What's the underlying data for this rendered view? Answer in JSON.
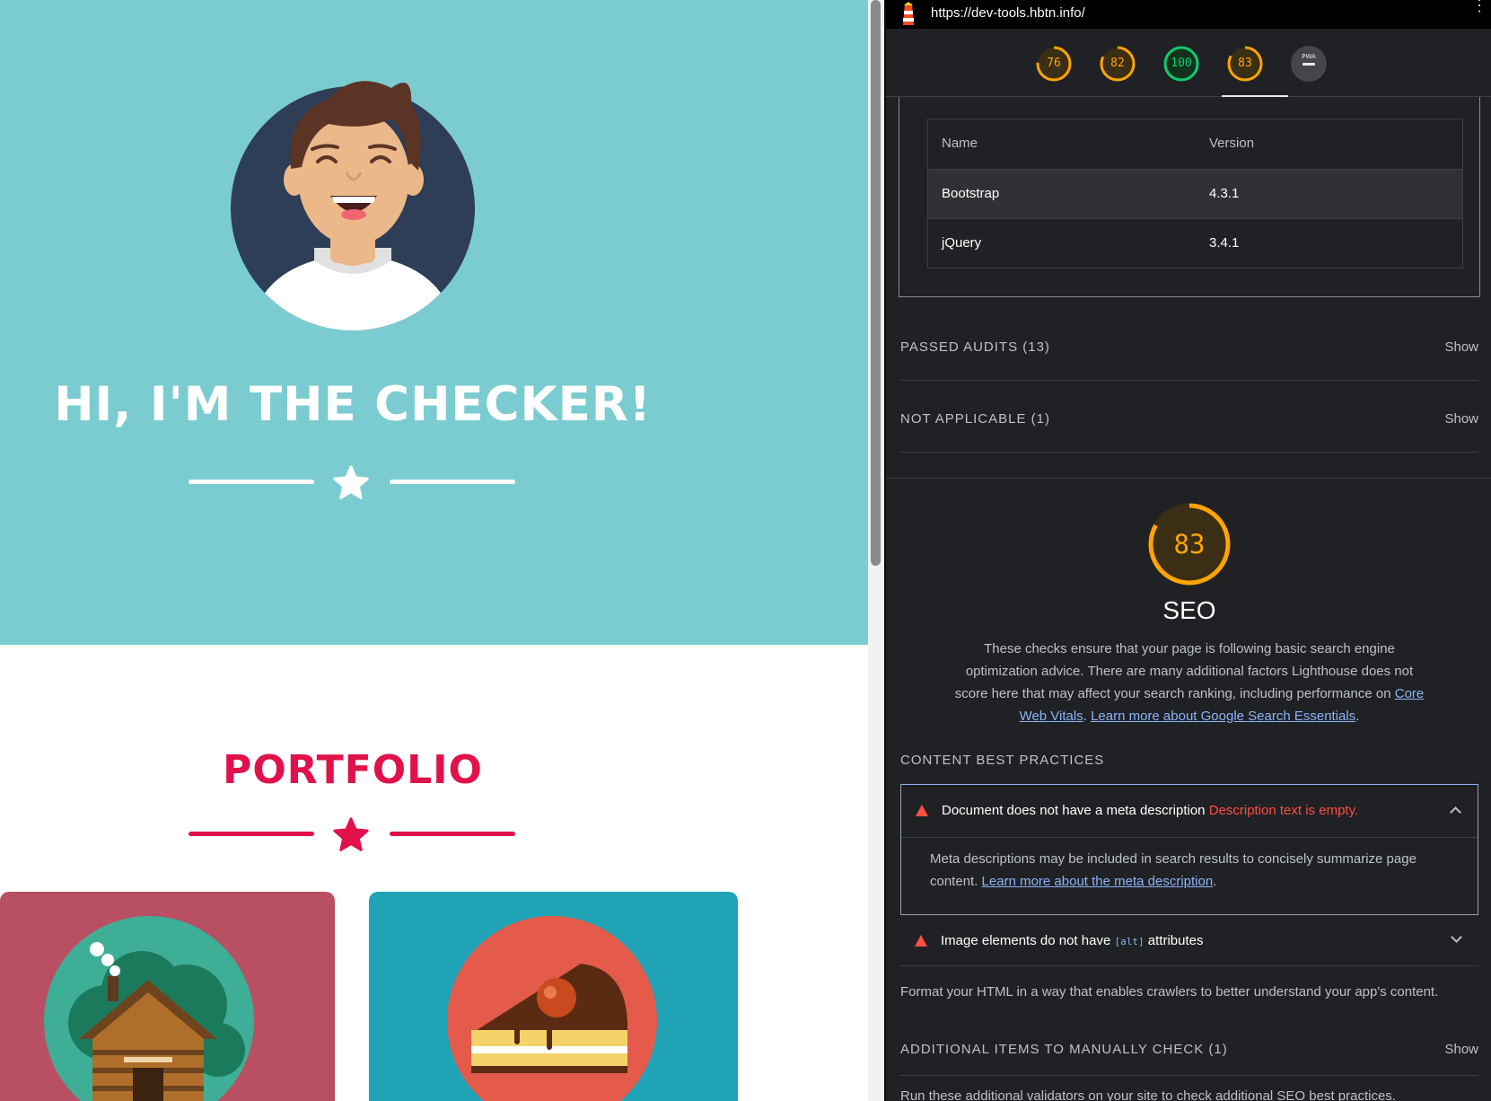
{
  "site": {
    "hero_title": "HI, I'M THE CHECKER!",
    "portfolio_title": "PORTFOLIO",
    "colors": {
      "hero_bg": "#7accd0",
      "accent": "#e0114b",
      "card1": "#b94f63",
      "card2": "#20a3b5"
    }
  },
  "lighthouse": {
    "url": "https://dev-tools.hbtn.info/",
    "scores": [
      {
        "value": "76",
        "color": "#ffa400",
        "fraction": 0.76
      },
      {
        "value": "82",
        "color": "#ffa400",
        "fraction": 0.82
      },
      {
        "value": "100",
        "color": "#0cce6b",
        "fraction": 1.0
      },
      {
        "value": "83",
        "color": "#ffa400",
        "fraction": 0.83
      }
    ],
    "pwa_label": "PWA",
    "libraries": {
      "headers": {
        "name": "Name",
        "version": "Version"
      },
      "rows": [
        {
          "name": "Bootstrap",
          "version": "4.3.1"
        },
        {
          "name": "jQuery",
          "version": "3.4.1"
        }
      ]
    },
    "passed_audits": "PASSED AUDITS (13)",
    "not_applicable": "NOT APPLICABLE (1)",
    "show_label": "Show",
    "seo": {
      "score": "83",
      "score_fraction": 0.83,
      "title": "SEO",
      "description": "These checks ensure that your page is following basic search engine optimization advice. There are many additional factors Lighthouse does not score here that may affect your search ranking, including performance on",
      "link1": "Core Web Vitals",
      "link2": "Learn more about Google Search Essentials"
    },
    "content_best_practices": "CONTENT BEST PRACTICES",
    "audit_meta": {
      "title": "Document does not have a meta description",
      "error": "Description text is empty.",
      "body": "Meta descriptions may be included in search results to concisely summarize page content.",
      "link": "Learn more about the meta description"
    },
    "audit_img": {
      "title_pre": "Image elements do not have",
      "code": "[alt]",
      "title_post": "attributes"
    },
    "format_text": "Format your HTML in a way that enables crawlers to better understand your app's content.",
    "manual_check": "ADDITIONAL ITEMS TO MANUALLY CHECK (1)",
    "manual_desc": "Run these additional validators on your site to check additional SEO best practices."
  }
}
